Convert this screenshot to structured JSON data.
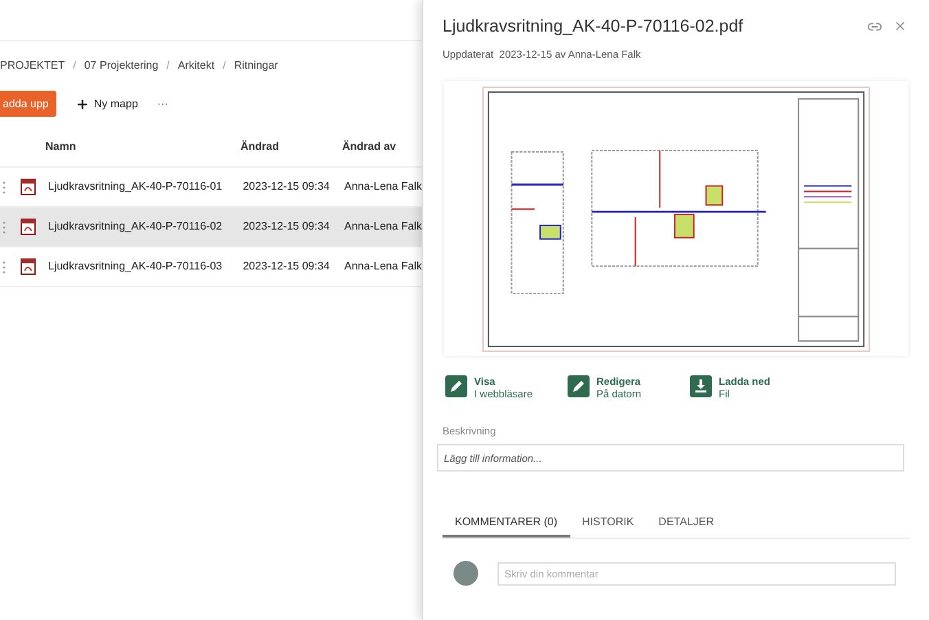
{
  "breadcrumb": [
    "PROJEKTET",
    "07 Projektering",
    "Arkitekt",
    "Ritningar"
  ],
  "breadcrumb_separator": "/",
  "toolbar": {
    "upload_button": "adda upp",
    "new_folder_button": "Ny mapp",
    "more_button": "···"
  },
  "table": {
    "columns": [
      "Namn",
      "Ändrad",
      "Ändrad av"
    ],
    "rows": [
      {
        "name": "Ljudkravsritning_AK-40-P-70116-01",
        "modified": "2023-12-15 09:34",
        "modified_by": "Anna-Lena Falk",
        "selected": false
      },
      {
        "name": "Ljudkravsritning_AK-40-P-70116-02",
        "modified": "2023-12-15 09:34",
        "modified_by": "Anna-Lena Falk",
        "selected": true
      },
      {
        "name": "Ljudkravsritning_AK-40-P-70116-03",
        "modified": "2023-12-15 09:34",
        "modified_by": "Anna-Lena Falk",
        "selected": false
      }
    ]
  },
  "panel": {
    "title": "Ljudkravsritning_AK-40-P-70116-02.pdf",
    "subtitle": "Uppdaterat  2023-12-15 av Anna-Lena Falk",
    "actions": [
      {
        "kind": "pencil",
        "label": "Visa",
        "sub": "I webbläsare"
      },
      {
        "kind": "pencil",
        "label": "Redigera",
        "sub": "På datorn"
      },
      {
        "kind": "download",
        "label": "Ladda ned",
        "sub": "Fil"
      }
    ],
    "description": {
      "label": "Beskrivning",
      "placeholder": "Lägg till information..."
    },
    "tabs": [
      {
        "label": "KOMMENTARER (0)",
        "selected": true
      },
      {
        "label": "HISTORIK",
        "selected": false
      },
      {
        "label": "DETALJER",
        "selected": false
      }
    ],
    "comment": {
      "placeholder": "Skriv din kommentar"
    }
  }
}
